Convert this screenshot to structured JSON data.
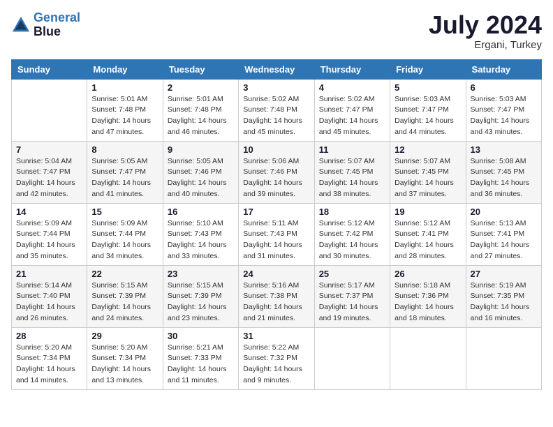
{
  "header": {
    "logo_line1": "General",
    "logo_line2": "Blue",
    "month_year": "July 2024",
    "location": "Ergani, Turkey"
  },
  "days_of_week": [
    "Sunday",
    "Monday",
    "Tuesday",
    "Wednesday",
    "Thursday",
    "Friday",
    "Saturday"
  ],
  "weeks": [
    [
      {
        "day": "",
        "info": ""
      },
      {
        "day": "1",
        "info": "Sunrise: 5:01 AM\nSunset: 7:48 PM\nDaylight: 14 hours\nand 47 minutes."
      },
      {
        "day": "2",
        "info": "Sunrise: 5:01 AM\nSunset: 7:48 PM\nDaylight: 14 hours\nand 46 minutes."
      },
      {
        "day": "3",
        "info": "Sunrise: 5:02 AM\nSunset: 7:48 PM\nDaylight: 14 hours\nand 45 minutes."
      },
      {
        "day": "4",
        "info": "Sunrise: 5:02 AM\nSunset: 7:47 PM\nDaylight: 14 hours\nand 45 minutes."
      },
      {
        "day": "5",
        "info": "Sunrise: 5:03 AM\nSunset: 7:47 PM\nDaylight: 14 hours\nand 44 minutes."
      },
      {
        "day": "6",
        "info": "Sunrise: 5:03 AM\nSunset: 7:47 PM\nDaylight: 14 hours\nand 43 minutes."
      }
    ],
    [
      {
        "day": "7",
        "info": "Sunrise: 5:04 AM\nSunset: 7:47 PM\nDaylight: 14 hours\nand 42 minutes."
      },
      {
        "day": "8",
        "info": "Sunrise: 5:05 AM\nSunset: 7:47 PM\nDaylight: 14 hours\nand 41 minutes."
      },
      {
        "day": "9",
        "info": "Sunrise: 5:05 AM\nSunset: 7:46 PM\nDaylight: 14 hours\nand 40 minutes."
      },
      {
        "day": "10",
        "info": "Sunrise: 5:06 AM\nSunset: 7:46 PM\nDaylight: 14 hours\nand 39 minutes."
      },
      {
        "day": "11",
        "info": "Sunrise: 5:07 AM\nSunset: 7:45 PM\nDaylight: 14 hours\nand 38 minutes."
      },
      {
        "day": "12",
        "info": "Sunrise: 5:07 AM\nSunset: 7:45 PM\nDaylight: 14 hours\nand 37 minutes."
      },
      {
        "day": "13",
        "info": "Sunrise: 5:08 AM\nSunset: 7:45 PM\nDaylight: 14 hours\nand 36 minutes."
      }
    ],
    [
      {
        "day": "14",
        "info": "Sunrise: 5:09 AM\nSunset: 7:44 PM\nDaylight: 14 hours\nand 35 minutes."
      },
      {
        "day": "15",
        "info": "Sunrise: 5:09 AM\nSunset: 7:44 PM\nDaylight: 14 hours\nand 34 minutes."
      },
      {
        "day": "16",
        "info": "Sunrise: 5:10 AM\nSunset: 7:43 PM\nDaylight: 14 hours\nand 33 minutes."
      },
      {
        "day": "17",
        "info": "Sunrise: 5:11 AM\nSunset: 7:43 PM\nDaylight: 14 hours\nand 31 minutes."
      },
      {
        "day": "18",
        "info": "Sunrise: 5:12 AM\nSunset: 7:42 PM\nDaylight: 14 hours\nand 30 minutes."
      },
      {
        "day": "19",
        "info": "Sunrise: 5:12 AM\nSunset: 7:41 PM\nDaylight: 14 hours\nand 28 minutes."
      },
      {
        "day": "20",
        "info": "Sunrise: 5:13 AM\nSunset: 7:41 PM\nDaylight: 14 hours\nand 27 minutes."
      }
    ],
    [
      {
        "day": "21",
        "info": "Sunrise: 5:14 AM\nSunset: 7:40 PM\nDaylight: 14 hours\nand 26 minutes."
      },
      {
        "day": "22",
        "info": "Sunrise: 5:15 AM\nSunset: 7:39 PM\nDaylight: 14 hours\nand 24 minutes."
      },
      {
        "day": "23",
        "info": "Sunrise: 5:15 AM\nSunset: 7:39 PM\nDaylight: 14 hours\nand 23 minutes."
      },
      {
        "day": "24",
        "info": "Sunrise: 5:16 AM\nSunset: 7:38 PM\nDaylight: 14 hours\nand 21 minutes."
      },
      {
        "day": "25",
        "info": "Sunrise: 5:17 AM\nSunset: 7:37 PM\nDaylight: 14 hours\nand 19 minutes."
      },
      {
        "day": "26",
        "info": "Sunrise: 5:18 AM\nSunset: 7:36 PM\nDaylight: 14 hours\nand 18 minutes."
      },
      {
        "day": "27",
        "info": "Sunrise: 5:19 AM\nSunset: 7:35 PM\nDaylight: 14 hours\nand 16 minutes."
      }
    ],
    [
      {
        "day": "28",
        "info": "Sunrise: 5:20 AM\nSunset: 7:34 PM\nDaylight: 14 hours\nand 14 minutes."
      },
      {
        "day": "29",
        "info": "Sunrise: 5:20 AM\nSunset: 7:34 PM\nDaylight: 14 hours\nand 13 minutes."
      },
      {
        "day": "30",
        "info": "Sunrise: 5:21 AM\nSunset: 7:33 PM\nDaylight: 14 hours\nand 11 minutes."
      },
      {
        "day": "31",
        "info": "Sunrise: 5:22 AM\nSunset: 7:32 PM\nDaylight: 14 hours\nand 9 minutes."
      },
      {
        "day": "",
        "info": ""
      },
      {
        "day": "",
        "info": ""
      },
      {
        "day": "",
        "info": ""
      }
    ]
  ]
}
